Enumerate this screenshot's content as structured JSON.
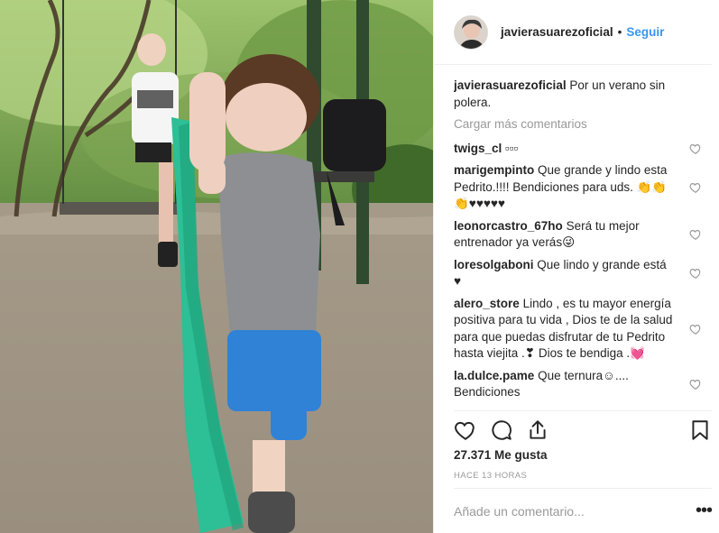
{
  "post": {
    "username": "javierasuarezoficial",
    "follow_label": "Seguir",
    "separator": "•",
    "caption": "Por un verano sin polera.",
    "load_more": "Cargar más comentarios",
    "likes": "27.371 Me gusta",
    "time": "HACE 13 HORAS",
    "add_comment_placeholder": "Añade un comentario...",
    "more_glyph": "•••"
  },
  "comments": [
    {
      "user": "twigs_cl",
      "text": "▫▫▫"
    },
    {
      "user": "marigempinto",
      "text": "Que grande y lindo esta Pedrito.!!!! Bendiciones para uds. 👏👏👏♥♥♥♥♥"
    },
    {
      "user": "leonorcastro_67ho",
      "text": "Será tu mejor entrenador ya verás😜"
    },
    {
      "user": "loresolgaboni",
      "text": "Que lindo y grande está ♥"
    },
    {
      "user": "alero_store",
      "text": "Lindo , es tu mayor energía positiva para tu vida , Dios te de la salud para que puedas disfrutar de tu Pedrito hasta viejita .❣ Dios te bendiga .💓"
    },
    {
      "user": "la.dulce.pame",
      "text": "Que ternura☺.... Bendiciones"
    }
  ],
  "icons": {
    "heart": "heart-icon",
    "comment": "comment-icon",
    "share": "share-icon",
    "save": "bookmark-icon"
  },
  "colors": {
    "link": "#3897f0",
    "muted": "#999999",
    "text": "#262626",
    "border": "#efefef"
  }
}
